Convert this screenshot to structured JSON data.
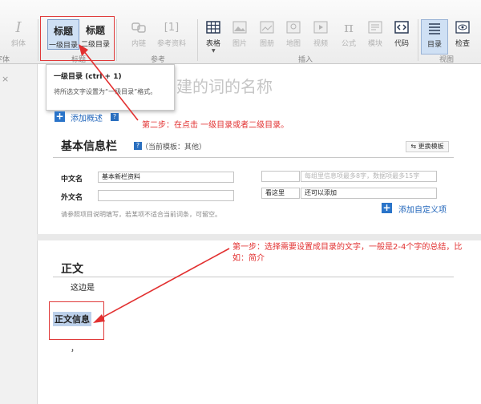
{
  "toolbar": {
    "italic": {
      "icon": "I",
      "label": "斜体"
    },
    "heading1": {
      "title": "标题",
      "label": "一级目录"
    },
    "heading2": {
      "title": "标题",
      "label": "二级目录"
    },
    "inner_link": {
      "label": "内链"
    },
    "reference": {
      "icon": "[1]",
      "label": "参考资料"
    },
    "table": {
      "label": "表格"
    },
    "image": {
      "label": "图片"
    },
    "album": {
      "label": "图册"
    },
    "map": {
      "label": "地图"
    },
    "video": {
      "label": "视频"
    },
    "formula": {
      "icon": "π",
      "label": "公式"
    },
    "module": {
      "label": "模块"
    },
    "code": {
      "label": "代码"
    },
    "toc": {
      "label": "目录"
    },
    "check": {
      "label": "检查"
    },
    "groups": {
      "font": "字体",
      "catalog": "标题",
      "reference": "参考",
      "insert": "插入",
      "view": "视图"
    }
  },
  "editor": {
    "title_placeholder": "建的词的名称",
    "tooltip": {
      "title": "一级目录 (ctrl + 1)",
      "desc": "将所选文字设置为“一级目录”格式。"
    },
    "add_summary": "添加概述",
    "help_icon": "?",
    "basic_info": {
      "title": "基本信息栏",
      "template": "（当前模板：其他）",
      "switch_template": "更换模板",
      "cn_name_label": "中文名",
      "cn_name_value": "基本新栏资料",
      "foreign_name_label": "外文名",
      "foreign_name_value": "",
      "right_input_placeholder": "每组里信息项最多8字，数据项最多15字",
      "custom_key": "看这里",
      "custom_value": "还可以添加",
      "hint": "请参照项目说明填写，若某项不适合当前词条，可留空。",
      "add_custom": "添加自定义项"
    },
    "body": {
      "title": "正文",
      "line1": "这边是",
      "selected_text": "正文信息",
      "line3": "，"
    }
  },
  "annotations": {
    "step2": "第二步：在点击 一级目录或者二级目录。",
    "step1": "第一步：选择需要设置成目录的文字，一般是2-4个字的总结，比如：简介"
  },
  "colors": {
    "annotation": "#e23030",
    "selection": "#bcd0ea",
    "link": "#2266bb"
  }
}
